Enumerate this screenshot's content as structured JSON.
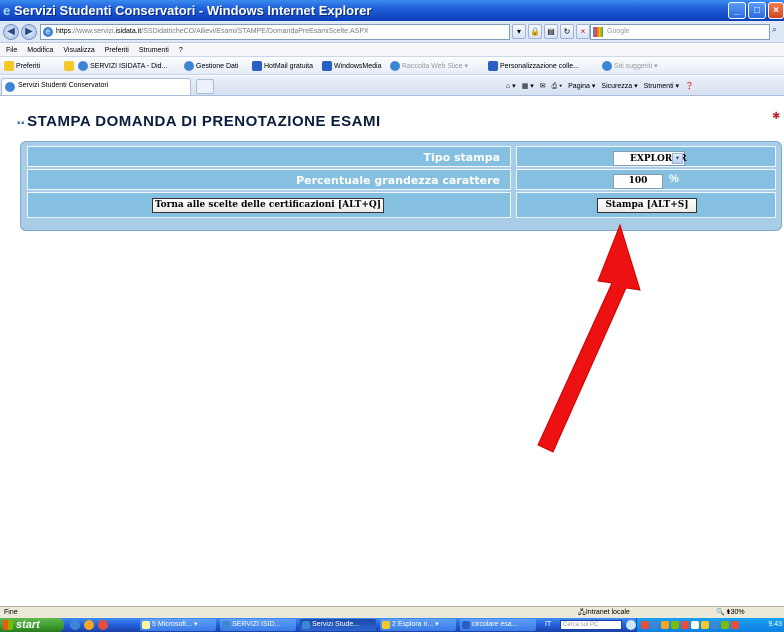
{
  "window": {
    "title": "Servizi Studenti Conservatori - Windows Internet Explorer",
    "min_btn": "_",
    "max_btn": "□",
    "close_btn": "×"
  },
  "address": {
    "url_scheme": "https",
    "url_prefix": "://www.servizi.",
    "url_domain": "isidata.it",
    "url_path": "/SSDidatticheCO/Allievi/Esami/STAMPE/DomandaPreEsamiScelte.ASPX",
    "search_placeholder": "Google"
  },
  "menu": [
    "File",
    "Modifica",
    "Visualizza",
    "Preferiti",
    "Strumenti",
    "?"
  ],
  "favorites": {
    "label": "Preferiti",
    "items": [
      {
        "label": "SERVIZI ISIDATA - Did...",
        "icon": "ie-page-icon"
      },
      {
        "label": "Gestione Dati",
        "icon": "ie-page-icon"
      },
      {
        "label": "HotMail gratuita",
        "icon": "msn-icon"
      },
      {
        "label": "WindowsMedia",
        "icon": "msn-icon"
      },
      {
        "label": "Raccolta Web Slice ▾",
        "icon": "ie-page-icon"
      },
      {
        "label": "Personalizzazione colle...",
        "icon": "msn-icon"
      },
      {
        "label": "Siti suggeriti ▾",
        "icon": "ie-page-icon"
      }
    ]
  },
  "tab": {
    "label": "Servizi Studenti Conservatori"
  },
  "command_bar": [
    "Pagina ▾",
    "Sicurezza ▾",
    "Strumenti ▾"
  ],
  "page": {
    "title": "STAMPA DOMANDA DI PRENOTAZIONE ESAMI",
    "tipo_stampa_label": "Tipo stampa",
    "tipo_stampa_value": "EXPLORER",
    "percentuale_label": "Percentuale grandezza carattere",
    "percentuale_value": "100",
    "percentuale_unit": "%",
    "torna_button": "Torna alle scelte delle certificazioni [ALT+Q]",
    "stampa_button": "Stampa [ALT+S]"
  },
  "status": {
    "left": "Fine",
    "zone": "Intranet locale",
    "zoom": "130%"
  },
  "taskbar": {
    "start": "start",
    "buttons": [
      {
        "label": "5 Microsoft... ▾",
        "active": false
      },
      {
        "label": "SERVIZI ISID...",
        "active": false
      },
      {
        "label": "Servizi Stude...",
        "active": true
      },
      {
        "label": "2 Esplora ri... ▾",
        "active": false
      },
      {
        "label": "circolare esa...",
        "active": false
      }
    ],
    "lang": "IT",
    "search_placeholder": "Cerca sul PC",
    "clock": "9.43"
  },
  "colors": {
    "panel_bg": "#a9cde6",
    "cell_bg": "#86c0e0",
    "arrow": "#ee1111"
  }
}
